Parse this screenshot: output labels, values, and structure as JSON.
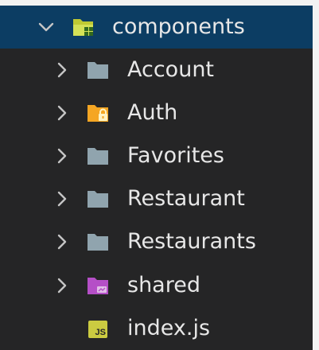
{
  "explorer": {
    "root": {
      "label": "components",
      "icon": "folder-components-open-icon",
      "expanded": true,
      "selected": true
    },
    "items": [
      {
        "label": "Account",
        "type": "folder",
        "icon": "folder-icon",
        "color": "#90a4ae"
      },
      {
        "label": "Auth",
        "type": "folder",
        "icon": "folder-lock-icon",
        "color": "#f5a623"
      },
      {
        "label": "Favorites",
        "type": "folder",
        "icon": "folder-icon",
        "color": "#90a4ae"
      },
      {
        "label": "Restaurant",
        "type": "folder",
        "icon": "folder-icon",
        "color": "#90a4ae"
      },
      {
        "label": "Restaurants",
        "type": "folder",
        "icon": "folder-icon",
        "color": "#90a4ae"
      },
      {
        "label": "shared",
        "type": "folder",
        "icon": "folder-shared-icon",
        "color": "#b54fc7"
      },
      {
        "label": "index.js",
        "type": "file",
        "icon": "javascript-file-icon",
        "badge": "JS",
        "color": "#cbcb41"
      }
    ]
  },
  "colors": {
    "background": "#252526",
    "selected_row": "#0c3d63",
    "text": "#e7e7e7",
    "chevron": "#c5c5c5"
  }
}
